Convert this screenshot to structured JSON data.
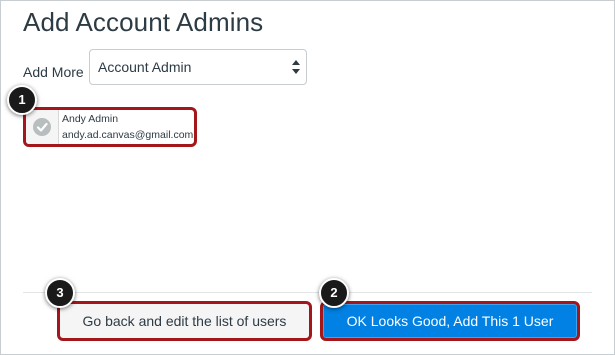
{
  "page": {
    "title": "Add Account Admins"
  },
  "role_picker": {
    "label": "Add More",
    "selected": "Account Admin"
  },
  "users": [
    {
      "name": "Andy Admin",
      "email": "andy.ad.canvas@gmail.com",
      "checked": true
    }
  ],
  "actions": {
    "back_label": "Go back and edit the list of users",
    "confirm_label": "OK Looks Good, Add This 1 User"
  },
  "callouts": {
    "user_card": "1",
    "confirm_button": "2",
    "back_button": "3"
  },
  "colors": {
    "highlight": "#a3161a",
    "primary": "#0081e3",
    "text": "#2d3b45",
    "secondary_bg": "#f5f5f5",
    "check_gray": "#b8bdc0"
  },
  "icons": {
    "check": "check-circle-icon",
    "select_arrows": "sort-arrows-icon"
  }
}
